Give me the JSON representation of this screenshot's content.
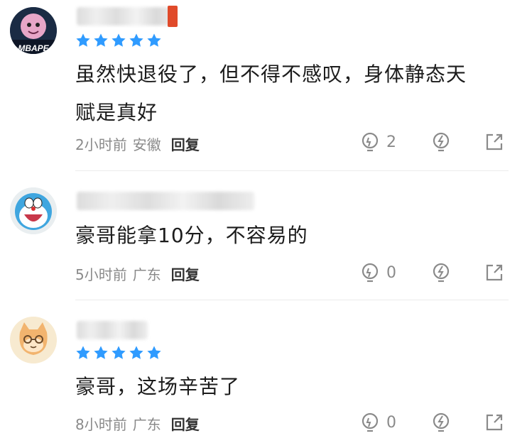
{
  "comments": [
    {
      "avatar": "mbape-avatar",
      "stars": 5,
      "text_line1": "虽然快退役了，但不得不感叹，身体静态天",
      "text_line2": "赋是真好",
      "time": "2小时前",
      "location": "安徽",
      "reply_label": "回复",
      "like_count": "2",
      "avatar_badge": "MBAPE"
    },
    {
      "avatar": "doraemon-avatar",
      "stars": 0,
      "text_line1": "豪哥能拿10分，不容易的",
      "time": "5小时前",
      "location": "广东",
      "reply_label": "回复",
      "like_count": "0"
    },
    {
      "avatar": "cat-avatar",
      "stars": 5,
      "text_line1": "豪哥，这场辛苦了",
      "time": "8小时前",
      "location": "广东",
      "reply_label": "回复",
      "like_count": "0"
    }
  ],
  "colors": {
    "star": "#2f9bff",
    "icon_gray": "#8a8a8a",
    "divider": "#ececec"
  },
  "icons": [
    "bulb-like-icon",
    "lightning-comment-icon",
    "share-icon",
    "star-icon"
  ]
}
